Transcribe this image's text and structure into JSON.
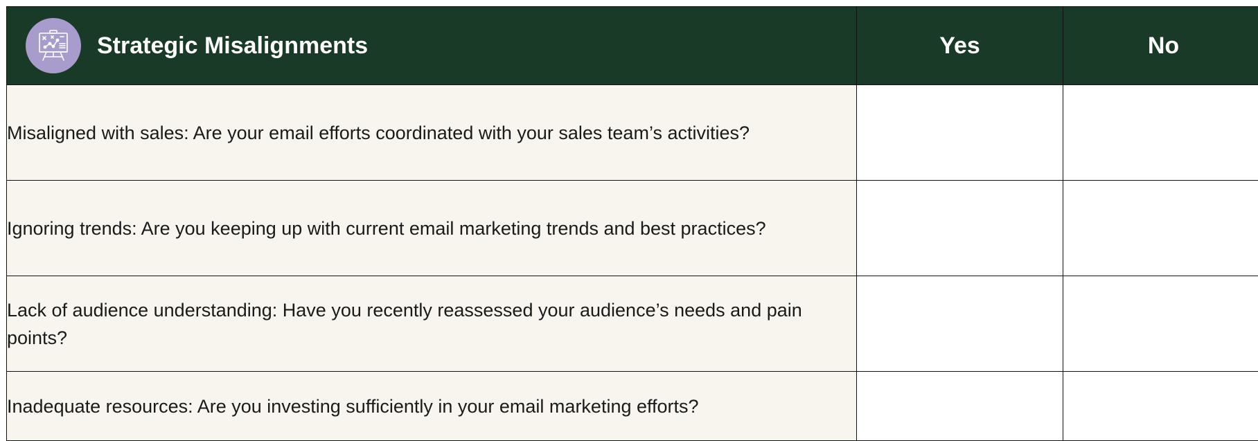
{
  "header": {
    "title": "Strategic Misalignments",
    "yes_label": "Yes",
    "no_label": "No",
    "icon": "presentation-board-icon",
    "bg_color": "#183a26",
    "icon_bg_color": "#a89ccd"
  },
  "rows": [
    {
      "question": "Misaligned with sales: Are your email efforts coordinated with your sales team’s activities?"
    },
    {
      "question": "Ignoring trends: Are you keeping up with current email marketing trends and best practices?"
    },
    {
      "question": "Lack of audience understanding: Have you recently reassessed your audience’s needs and pain points?"
    },
    {
      "question": "Inadequate resources: Are you investing sufficiently in your email marketing efforts?"
    }
  ]
}
